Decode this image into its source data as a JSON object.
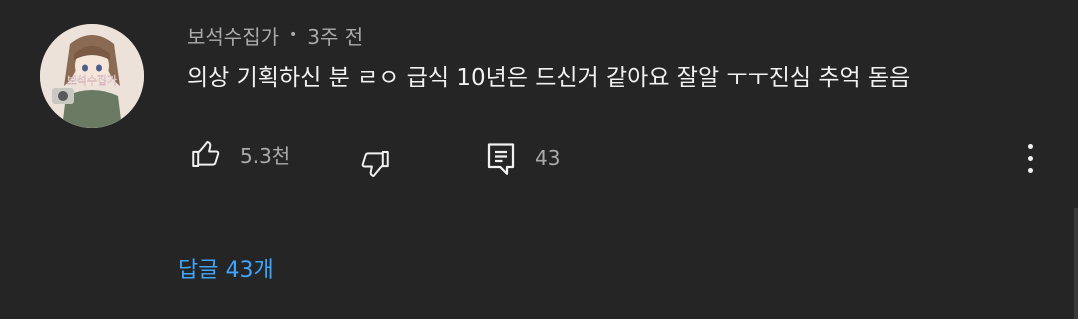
{
  "comment": {
    "author": "보석수집가",
    "separator": "•",
    "time": "3주 전",
    "text": "의상 기획하신 분 ㄹㅇ 급식 10년은 드신거 같아요 잘알 ㅜㅜ진심 추억 돋음",
    "avatar_icon": "avatar-image",
    "avatar_text": "보석수집가"
  },
  "actions": {
    "like_icon": "thumbs-up-icon",
    "like_count": "5.3천",
    "dislike_icon": "thumbs-down-icon",
    "reply_icon": "reply-comment-icon",
    "reply_count": "43",
    "more_icon": "more-vertical-icon"
  },
  "replies": {
    "label": "답글 43개",
    "color": "#3ea6ff"
  },
  "theme": {
    "background": "#252525",
    "text_primary": "#f1f1f1",
    "text_secondary": "#aaaaaa"
  }
}
